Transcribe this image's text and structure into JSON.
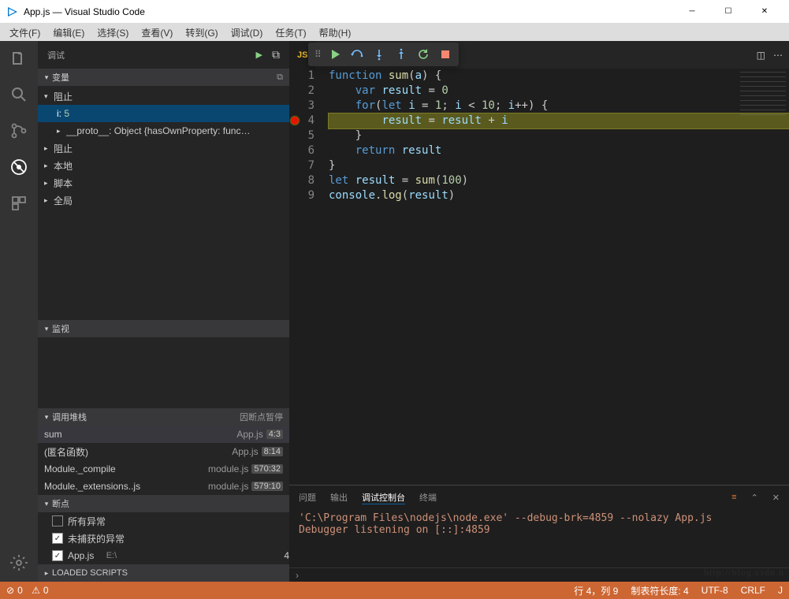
{
  "window": {
    "title": "App.js — Visual Studio Code"
  },
  "menu": [
    "文件(F)",
    "编辑(E)",
    "选择(S)",
    "查看(V)",
    "转到(G)",
    "调试(D)",
    "任务(T)",
    "帮助(H)"
  ],
  "sidebar": {
    "title": "调试",
    "sections": {
      "variables": {
        "label": "变量",
        "groups": {
          "block": {
            "label": "阻止",
            "items": [
              {
                "name": "i",
                "value": "5"
              },
              {
                "name": "__proto__",
                "value": "Object {hasOwnProperty: func…"
              }
            ]
          },
          "block2": {
            "label": "阻止"
          },
          "local": {
            "label": "本地"
          },
          "script": {
            "label": "脚本"
          },
          "global": {
            "label": "全局"
          }
        }
      },
      "watch": {
        "label": "监视"
      },
      "callstack": {
        "label": "调用堆栈",
        "status": "因断点暂停",
        "frames": [
          {
            "name": "sum",
            "file": "App.js",
            "pos": "4:3"
          },
          {
            "name": "(匿名函数)",
            "file": "App.js",
            "pos": "8:14"
          },
          {
            "name": "Module._compile",
            "file": "module.js",
            "pos": "570:32"
          },
          {
            "name": "Module._extensions..js",
            "file": "module.js",
            "pos": "579:10"
          }
        ]
      },
      "breakpoints": {
        "label": "断点",
        "items": [
          {
            "checked": false,
            "label": "所有异常"
          },
          {
            "checked": true,
            "label": "未捕获的异常"
          },
          {
            "checked": true,
            "label": "App.js",
            "extra": "E:\\",
            "badge": "4"
          }
        ]
      },
      "loaded": {
        "label": "LOADED SCRIPTS"
      }
    }
  },
  "editor": {
    "filename": "App.js",
    "lines": [
      "function sum(a) {",
      "    var result = 0",
      "    for(let i = 1; i < 10; i++) {",
      "        result = result + i",
      "    }",
      "    return result",
      "}",
      "let result = sum(100)",
      "console.log(result)"
    ],
    "currentLine": 4,
    "breakpointLine": 4
  },
  "panel": {
    "tabs": [
      "问题",
      "输出",
      "调试控制台",
      "终端"
    ],
    "active": 2,
    "lines": [
      "'C:\\Program Files\\nodejs\\node.exe' --debug-brk=4859 --nolazy App.js",
      "Debugger listening on [::]:4859"
    ]
  },
  "statusbar": {
    "errors": "0",
    "warnings": "0",
    "line": "行 4，列 9",
    "tabsize": "制表符长度: 4",
    "encoding": "UTF-8",
    "eol": "CRLF",
    "lang": "J"
  },
  "watermark": "http://blog.csdn.n"
}
